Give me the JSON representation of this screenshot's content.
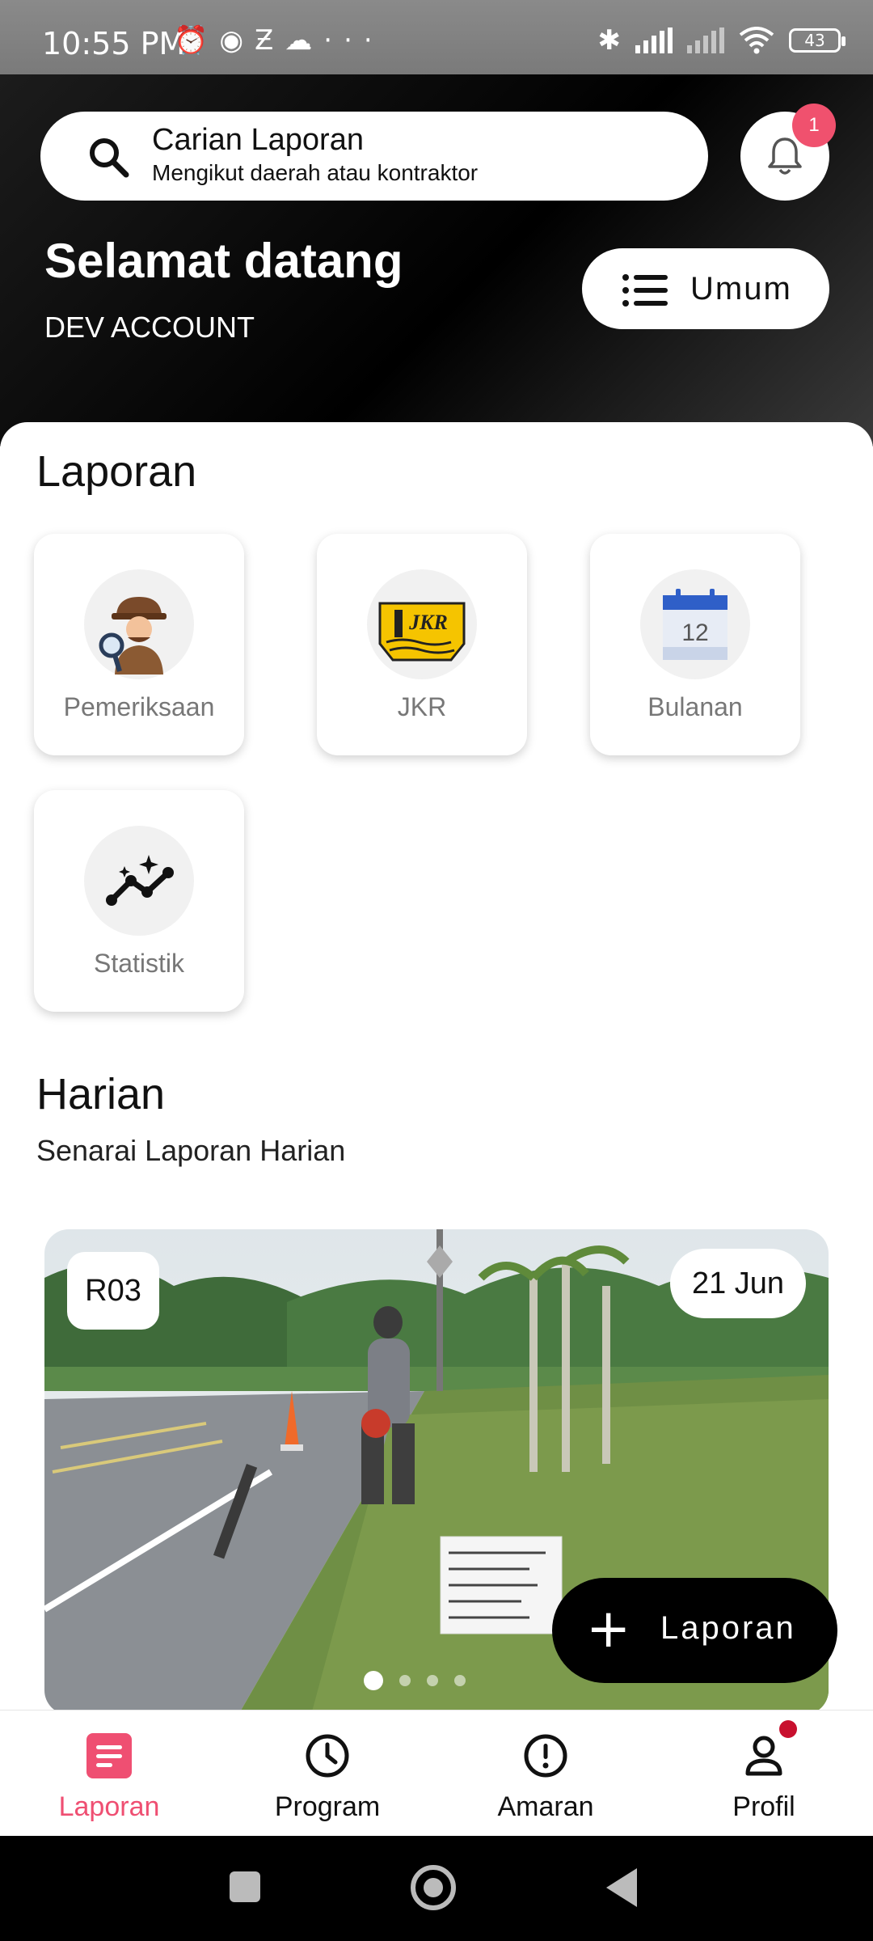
{
  "status_bar": {
    "time": "10:55 PM",
    "battery": "43",
    "left_icons": [
      "alarm-off-icon",
      "message-icon",
      "app-icon",
      "cloud-icon",
      "more-icon"
    ],
    "right_icons": [
      "bluetooth-icon",
      "signal-icon",
      "signal-icon",
      "wifi-icon",
      "battery-icon"
    ]
  },
  "header": {
    "search_title": "Carian Laporan",
    "search_subtitle": "Mengikut daerah atau kontraktor",
    "notification_count": "1",
    "welcome": "Selamat datang",
    "account_name": "DEV ACCOUNT",
    "category_button": "Umum"
  },
  "laporan": {
    "title": "Laporan",
    "tiles": [
      {
        "label": "Pemeriksaan",
        "icon": "detective-icon"
      },
      {
        "label": "JKR",
        "icon": "jkr-logo"
      },
      {
        "label": "Bulanan",
        "icon": "calendar-icon"
      },
      {
        "label": "Statistik",
        "icon": "stats-icon"
      }
    ],
    "jkr_logo_text": "JKR",
    "calendar_day": "12"
  },
  "harian": {
    "title": "Harian",
    "subtitle": "Senarai Laporan Harian",
    "card": {
      "route": "R03",
      "date": "21 Jun",
      "slide_count": 4,
      "active_slide": 1
    }
  },
  "fab": {
    "icon": "plus-icon",
    "label": "Laporan"
  },
  "bottom_nav": {
    "items": [
      {
        "label": "Laporan",
        "icon": "report-icon",
        "active": true
      },
      {
        "label": "Program",
        "icon": "clock-icon",
        "active": false
      },
      {
        "label": "Amaran",
        "icon": "alert-icon",
        "active": false
      },
      {
        "label": "Profil",
        "icon": "person-icon",
        "active": false
      }
    ]
  },
  "colors": {
    "accent": "#ef4f72",
    "badge": "#f0516e",
    "profile_dot": "#c8102e"
  }
}
